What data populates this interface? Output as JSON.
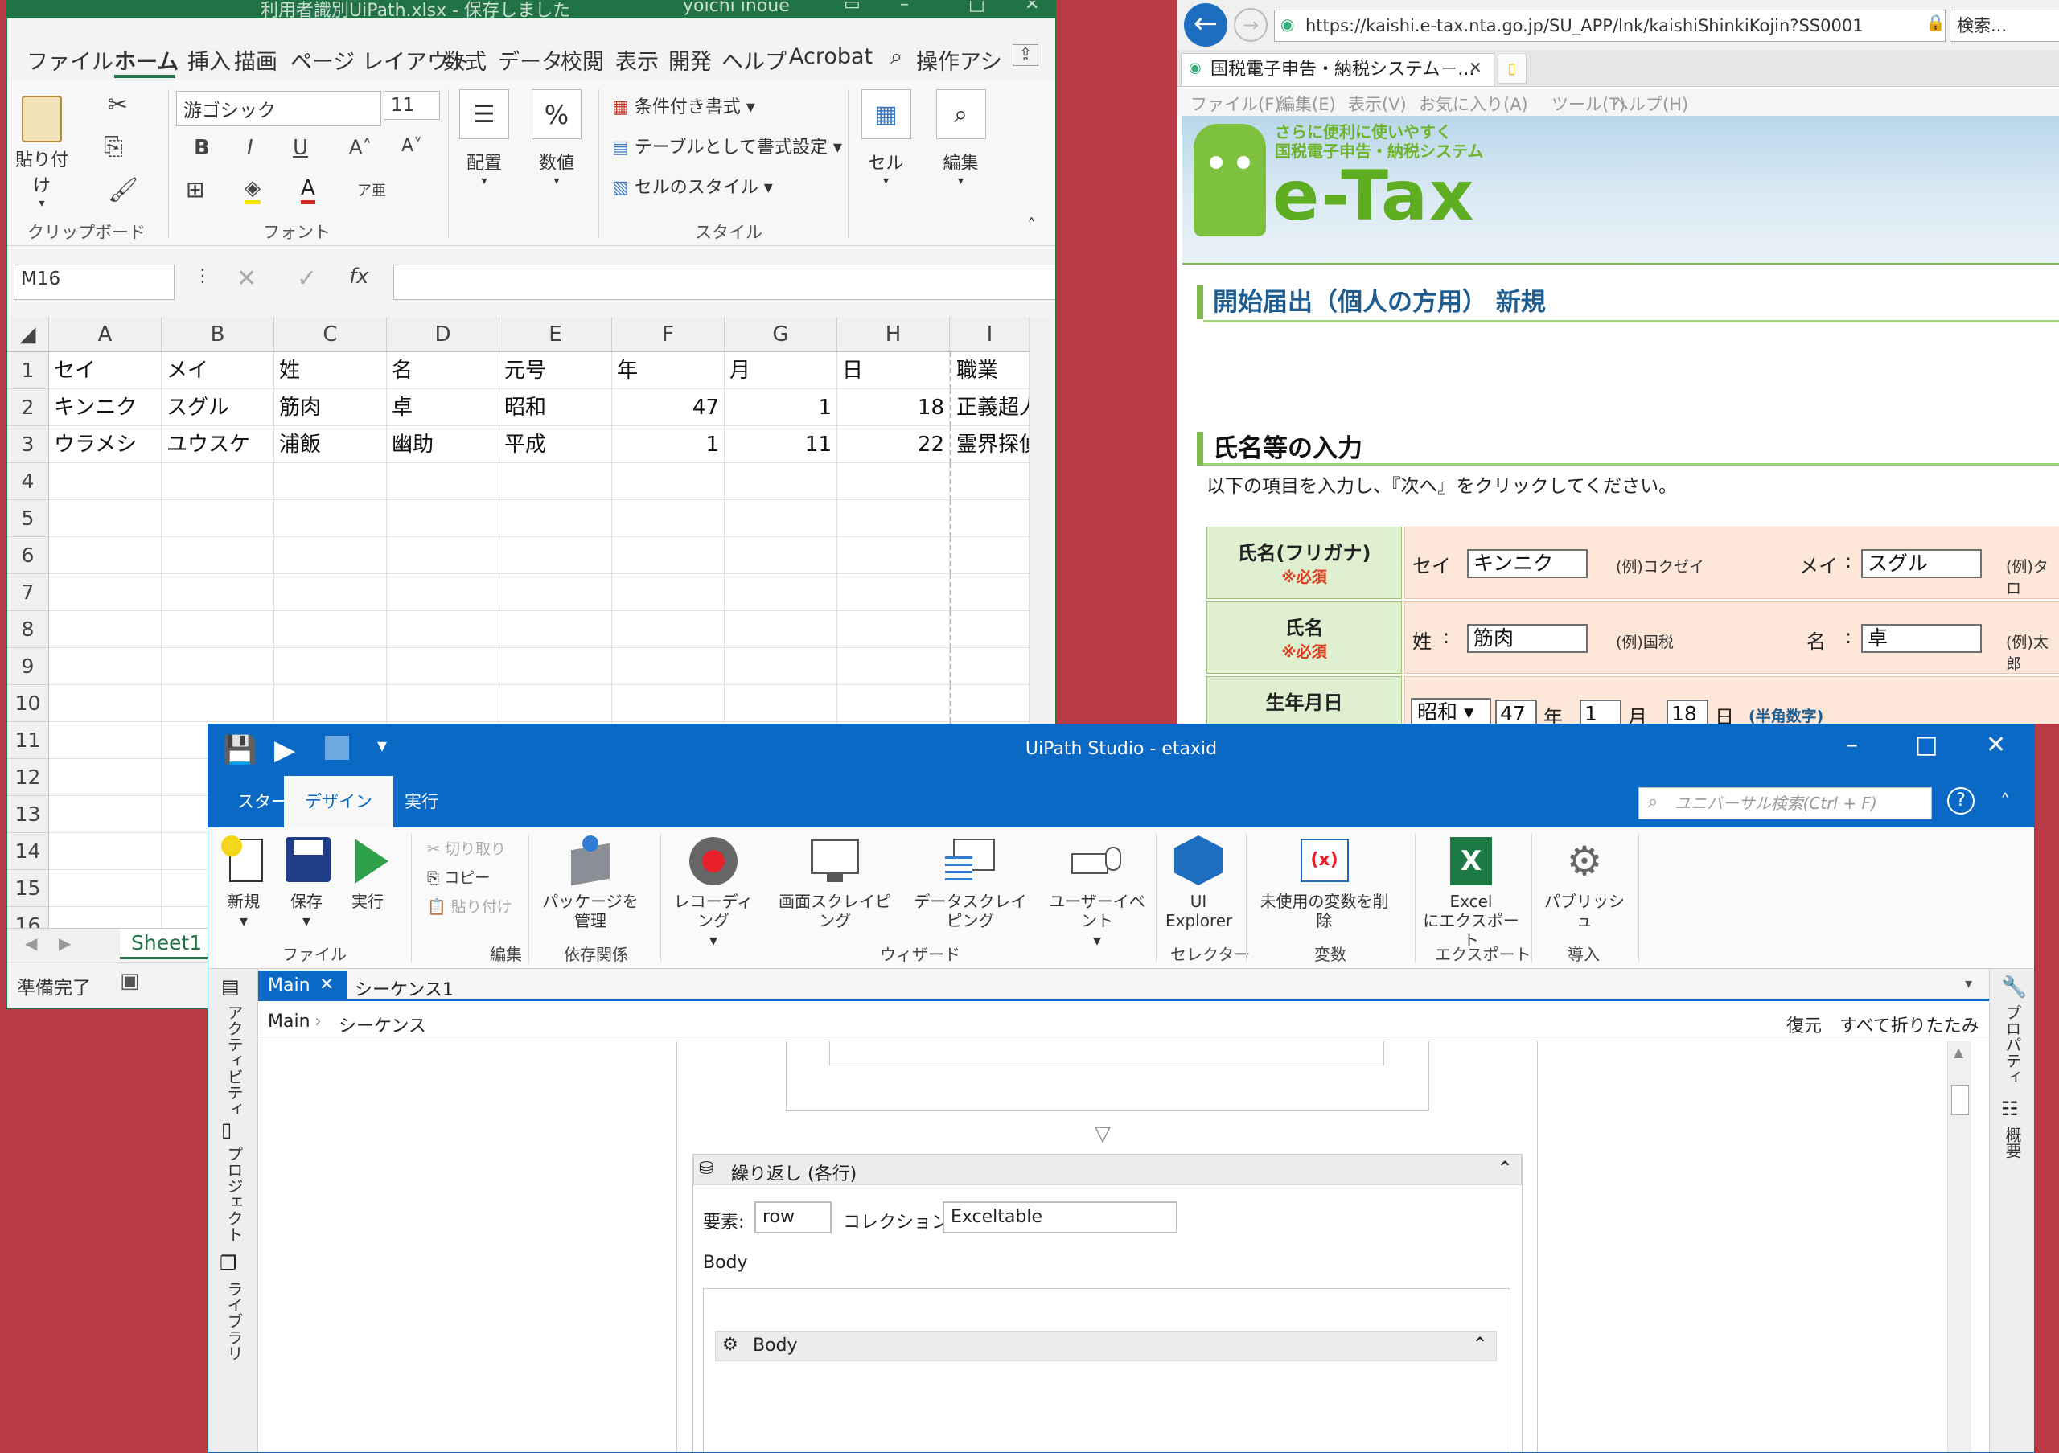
{
  "excel": {
    "title": "利用者識別UiPath.xlsx  -  保存しました",
    "user": "yoichi inoue",
    "menu": [
      "ファイル",
      "ホーム",
      "挿入",
      "描画",
      "ページ レイアウト",
      "数式",
      "データ",
      "校閲",
      "表示",
      "開発",
      "ヘルプ",
      "Acrobat"
    ],
    "search_hint": "操作アシ",
    "ribbon": {
      "paste": "貼り付け",
      "font_name": "游ゴシック",
      "font_size": "11",
      "align": "配置",
      "number": "数値",
      "cond_format": "条件付き書式",
      "table_format": "テーブルとして書式設定",
      "cell_style": "セルのスタイル",
      "cells": "セル",
      "edit": "編集",
      "group_clipboard": "クリップボード",
      "group_font": "フォント",
      "group_style": "スタイル"
    },
    "name_box": "M16",
    "fx": "fx",
    "columns": [
      "A",
      "B",
      "C",
      "D",
      "E",
      "F",
      "G",
      "H",
      "I"
    ],
    "rows": [
      "1",
      "2",
      "3",
      "4",
      "5",
      "6",
      "7",
      "8",
      "9",
      "10",
      "11",
      "12",
      "13",
      "14",
      "15",
      "16"
    ],
    "data": [
      [
        "セイ",
        "メイ",
        "姓",
        "名",
        "元号",
        "年",
        "月",
        "日",
        "職業"
      ],
      [
        "キンニク",
        "スグル",
        "筋肉",
        "卓",
        "昭和",
        "47",
        "1",
        "18",
        "正義超人"
      ],
      [
        "ウラメシ",
        "ユウスケ",
        "浦飯",
        "幽助",
        "平成",
        "1",
        "11",
        "22",
        "霊界探偵"
      ]
    ],
    "sheet": "Sheet1",
    "status": "準備完了"
  },
  "ie": {
    "url": "https://kaishi.e-tax.nta.go.jp/SU_APP/lnk/kaishiShinkiKojin?SS0001",
    "search": "検索...",
    "tab": "国税電子申告・納税システム－...",
    "menu": [
      "ファイル(F)",
      "編集(E)",
      "表示(V)",
      "お気に入り(A)",
      "ツール(T)",
      "ヘルプ(H)"
    ],
    "logo_tag1": "さらに便利に使いやすく",
    "logo_tag2": "国税電子申告・納税システム",
    "logo": "e-Tax",
    "h1": "開始届出（個人の方用） 新規",
    "h2": "氏名等の入力",
    "instr": "以下の項目を入力し、『次へ』をクリックしてください。",
    "required": "※必須",
    "rows": [
      {
        "label": "氏名(フリガナ)",
        "k1": "セイ",
        "v1": "キンニク",
        "ex1": "(例)コクゼイ",
        "k2": "メイ",
        "v2": "スグル",
        "ex2": "(例)タロ"
      },
      {
        "label": "氏名",
        "k1": "姓",
        "v1": "筋肉",
        "ex1": "(例)国税",
        "k2": "名",
        "v2": "卓",
        "ex2": "(例)太郎"
      }
    ],
    "dob_label": "生年月日",
    "era": "昭和",
    "year": "47",
    "year_u": "年",
    "month": "1",
    "month_u": "月",
    "day": "18",
    "day_u": "日",
    "half": "(半角数字)"
  },
  "uipath": {
    "title": "UiPath Studio - etaxid",
    "tabs": [
      "スタート",
      "デザイン",
      "実行"
    ],
    "search": "ユニバーサル検索(Ctrl + F)",
    "ribbon": {
      "new": "新規",
      "save": "保存",
      "run": "実行",
      "cut": "切り取り",
      "copy": "コピー",
      "paste": "貼り付け",
      "pkg": "パッケージを管理",
      "rec": "レコーディング",
      "screen": "画面スクレイピング",
      "data": "データスクレイピング",
      "user": "ユーザーイベント",
      "uie1": "UI",
      "uie2": "Explorer",
      "unused": "未使用の変数を削除",
      "xl1": "Excel",
      "xl2": "にエクスポート",
      "pub": "パブリッシュ"
    },
    "groups": {
      "file": "ファイル",
      "edit": "編集",
      "dep": "依存関係",
      "wiz": "ウィザード",
      "sel": "セレクター",
      "var": "変数",
      "exp": "エクスポート",
      "deploy": "導入"
    },
    "left_panels": [
      "アクティビティ",
      "プロジェクト",
      "ライブラリ"
    ],
    "right_panels": [
      "プロパティ",
      "概要"
    ],
    "doc_tabs": [
      "Main",
      "シーケンス1"
    ],
    "bc1": "Main",
    "bc2": "シーケンス",
    "restore": "復元",
    "collapse": "すべて折りたたみ",
    "foreach": "繰り返し (各行)",
    "elem_label": "要素:",
    "elem": "row",
    "coll_label": "コレクション:",
    "coll": "Exceltable",
    "body_label": "Body",
    "body": "Body"
  }
}
